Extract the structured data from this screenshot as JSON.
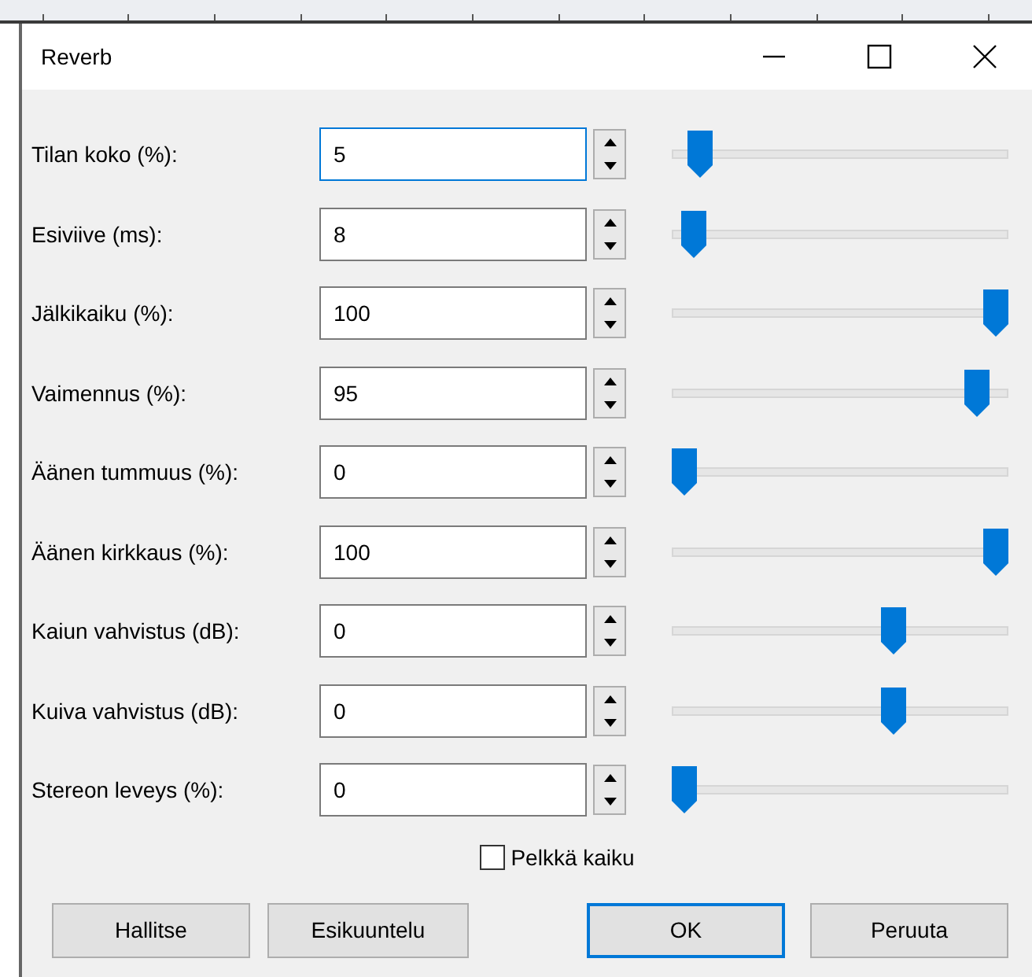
{
  "window": {
    "title": "Reverb"
  },
  "params": [
    {
      "label": "Tilan koko (%):",
      "value": "5",
      "focused": true,
      "level": 0.05
    },
    {
      "label": "Esiviive (ms):",
      "value": "8",
      "focused": false,
      "level": 0.03
    },
    {
      "label": "Jälkikaiku (%):",
      "value": "100",
      "focused": false,
      "level": 1
    },
    {
      "label": "Vaimennus (%):",
      "value": "95",
      "focused": false,
      "level": 0.94
    },
    {
      "label": "Äänen tummuus (%):",
      "value": "0",
      "focused": false,
      "level": 0
    },
    {
      "label": "Äänen kirkkaus (%):",
      "value": "100",
      "focused": false,
      "level": 1
    },
    {
      "label": "Kaiun vahvistus (dB):",
      "value": "0",
      "focused": false,
      "level": 0.67
    },
    {
      "label": "Kuiva vahvistus (dB):",
      "value": "0",
      "focused": false,
      "level": 0.67
    },
    {
      "label": "Stereon leveys (%):",
      "value": "0",
      "focused": false,
      "level": 0
    }
  ],
  "wet_only": {
    "label": "Pelkkä kaiku",
    "checked": false
  },
  "buttons": [
    {
      "label": "Hallitse",
      "default": false
    },
    {
      "label": "Esikuuntelu",
      "default": false
    },
    {
      "label": "OK",
      "default": true
    },
    {
      "label": "Peruuta",
      "default": false
    }
  ]
}
